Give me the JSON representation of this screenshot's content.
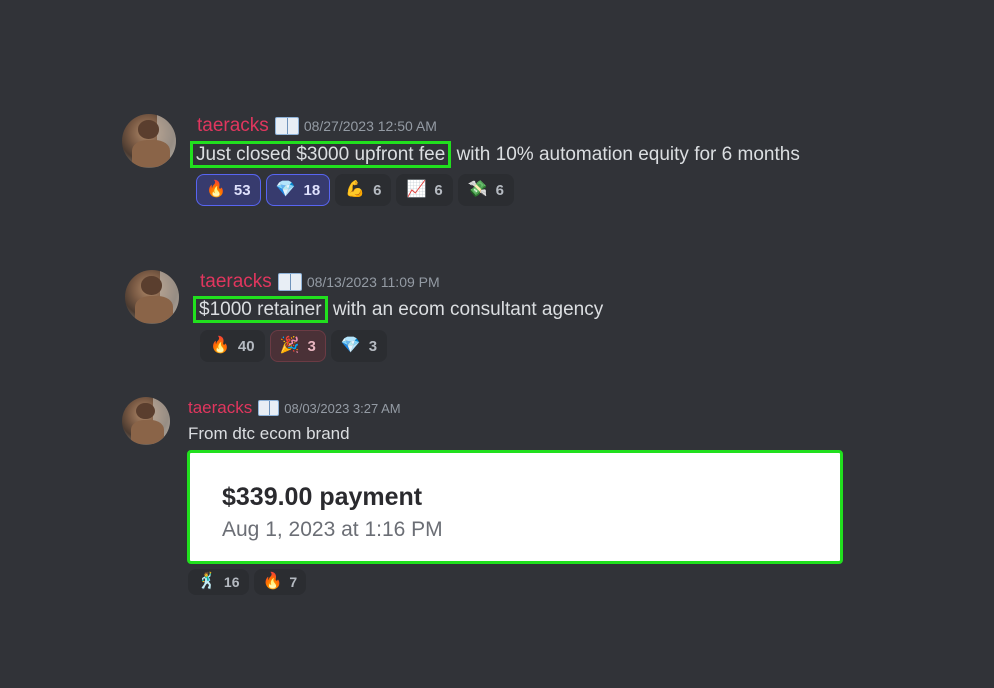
{
  "messages": [
    {
      "username": "taeracks",
      "timestamp": "08/27/2023 12:50 AM",
      "highlight": "Just closed $3000 upfront fee",
      "rest": " with 10% automation equity for 6 months",
      "reactions": [
        {
          "emoji": "🔥",
          "icon": "fire-icon",
          "count": "53"
        },
        {
          "emoji": "💎",
          "icon": "gem-icon",
          "count": "18"
        },
        {
          "emoji": "💪",
          "icon": "flexed-biceps-icon",
          "count": "6"
        },
        {
          "emoji": "📈",
          "icon": "chart-increasing-icon",
          "count": "6"
        },
        {
          "emoji": "💸",
          "icon": "money-with-wings-icon",
          "count": "6"
        }
      ]
    },
    {
      "username": "taeracks",
      "timestamp": "08/13/2023 11:09 PM",
      "highlight": "$1000 retainer",
      "rest": " with an ecom consultant agency",
      "reactions": [
        {
          "emoji": "🔥",
          "icon": "fire-icon",
          "count": "40"
        },
        {
          "emoji": "🎉",
          "icon": "party-popper-icon",
          "count": "3"
        },
        {
          "emoji": "💎",
          "icon": "gem-icon",
          "count": "3"
        }
      ]
    },
    {
      "username": "taeracks",
      "timestamp": "08/03/2023 3:27 AM",
      "text": "From dtc ecom brand",
      "embed": {
        "title": "$339.00 payment",
        "subtitle": "Aug 1, 2023 at 1:16 PM"
      },
      "reactions": [
        {
          "emoji": "🕺",
          "icon": "dancer-icon",
          "count": "16"
        },
        {
          "emoji": "🔥",
          "icon": "fire-icon",
          "count": "7"
        }
      ]
    }
  ],
  "colors": {
    "background": "#313338",
    "username": "#e0365e",
    "highlight_border": "#21e01e",
    "reaction_active": "#5865f2"
  }
}
